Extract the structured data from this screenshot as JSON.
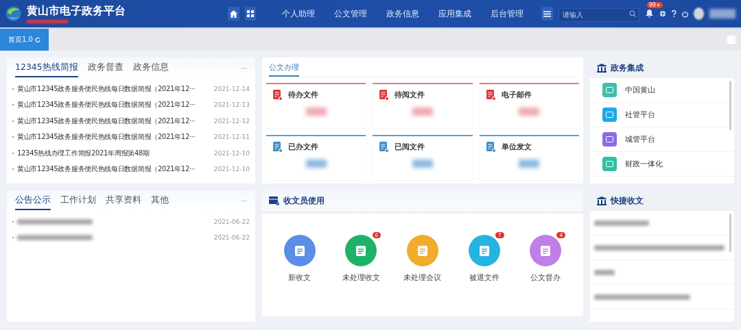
{
  "header": {
    "title": "黄山市电子政务平台",
    "nav": [
      {
        "label": "个人助理"
      },
      {
        "label": "公文管理"
      },
      {
        "label": "政务信息"
      },
      {
        "label": "应用集成"
      },
      {
        "label": "后台管理"
      }
    ],
    "search": {
      "placeholder": "请输入"
    },
    "notification_badge": "99+"
  },
  "tabs": [
    {
      "label": "首页1.0",
      "selected": true
    }
  ],
  "hotline": {
    "tabs": [
      {
        "label": "12345热线简报",
        "selected": true
      },
      {
        "label": "政务督查",
        "selected": false
      },
      {
        "label": "政务信息",
        "selected": false
      }
    ],
    "more": "···",
    "items": [
      {
        "title": "黄山市12345政务服务便民热线每日数据简报（2021年12···",
        "date": "2021-12-14"
      },
      {
        "title": "黄山市12345政务服务便民热线每日数据简报（2021年12···",
        "date": "2021-12-13"
      },
      {
        "title": "黄山市12345政务服务便民热线每日数据简报（2021年12···",
        "date": "2021-12-12"
      },
      {
        "title": "黄山市12345政务服务便民热线每日数据简报（2021年12···",
        "date": "2021-12-11"
      },
      {
        "title": "12345热线办理工作简报2021年周报第48期",
        "date": "2021-12-10"
      },
      {
        "title": "黄山市12345政务服务便民热线每日数据简报（2021年12···",
        "date": "2021-12-10"
      }
    ]
  },
  "documents": {
    "tab": "公文办理",
    "cards": [
      {
        "label": "待办文件",
        "kind": "pending"
      },
      {
        "label": "待阅文件",
        "kind": "pending"
      },
      {
        "label": "电子邮件",
        "kind": "pending"
      },
      {
        "label": "已办文件",
        "kind": "done"
      },
      {
        "label": "已阅文件",
        "kind": "done"
      },
      {
        "label": "单位发文",
        "kind": "done"
      }
    ]
  },
  "integration": {
    "title": "政务集成",
    "items": [
      {
        "label": "中国黄山",
        "color": "#3fbfae"
      },
      {
        "label": "社管平台",
        "color": "#1ea7e8"
      },
      {
        "label": "城管平台",
        "color": "#8a6ae6"
      },
      {
        "label": "财政一体化",
        "color": "#2fbfa2"
      }
    ]
  },
  "notices": {
    "tabs": [
      {
        "label": "公告公示",
        "selected": true
      },
      {
        "label": "工作计划",
        "selected": false
      },
      {
        "label": "共享资料",
        "selected": false
      },
      {
        "label": "其他",
        "selected": false
      }
    ],
    "more": "···",
    "items": [
      {
        "date": "2021-06-22"
      },
      {
        "date": "2021-06-22"
      }
    ]
  },
  "clerk": {
    "title": "收文员使用",
    "actions": [
      {
        "label": "新收文",
        "color": "#5b8ee6"
      },
      {
        "label": "未处理收文",
        "color": "#1fb36a",
        "badge": "6"
      },
      {
        "label": "未处理会议",
        "color": "#f0ac2a"
      },
      {
        "label": "被退文件",
        "color": "#25b4e0",
        "badge": "7"
      },
      {
        "label": "公文督办",
        "color": "#c07ee8",
        "badge": "4"
      }
    ]
  },
  "quick_receive": {
    "title": "快捷收文",
    "items": [
      {
        "kind": "blurred"
      },
      {
        "kind": "blurred"
      },
      {
        "kind": "blurred"
      },
      {
        "kind": "blurred"
      }
    ]
  }
}
